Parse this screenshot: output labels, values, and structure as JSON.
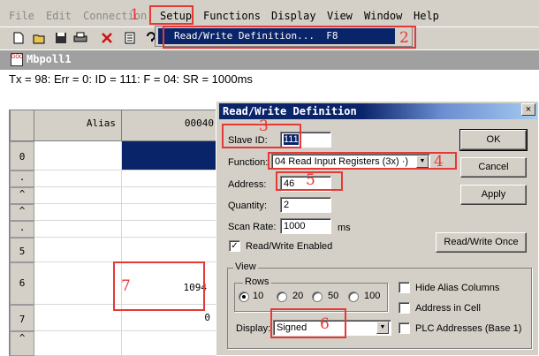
{
  "menu": [
    "File",
    "Edit",
    "Connection",
    "Setup",
    "Functions",
    "Display",
    "View",
    "Window",
    "Help"
  ],
  "setup_menu": {
    "item_label": "Read/Write Definition...",
    "item_shortcut": "F8"
  },
  "child_window": {
    "title": "Mbpoll1"
  },
  "status": "Tx = 98: Err = 0: ID = 111: F = 04: SR = 1000ms",
  "grid": {
    "alias_header": "Alias",
    "address_header": "00040",
    "rows": [
      {
        "row": "0",
        "value": ""
      },
      {
        "row": ".",
        "value": ""
      },
      {
        "row": "^",
        "value": ""
      },
      {
        "row": "^",
        "value": ""
      },
      {
        "row": ".",
        "value": ""
      },
      {
        "row": "5",
        "value": ""
      },
      {
        "row": "6",
        "value": "1094"
      },
      {
        "row": "7",
        "value": "0"
      },
      {
        "row": "^",
        "value": ""
      }
    ]
  },
  "dialog": {
    "title": "Read/Write Definition",
    "close_glyph": "×",
    "slave_id_label": "Slave ID:",
    "slave_id": "111",
    "function_label": "Function:",
    "function_value": "04 Read Input Registers (3x)",
    "function_trunc": " ·)",
    "address_label": "Address:",
    "address": "46",
    "quantity_label": "Quantity:",
    "quantity": "2",
    "scan_rate_label": "Scan Rate:",
    "scan_rate": "1000",
    "scan_rate_unit": "ms",
    "rw_enabled_label": "Read/Write Enabled",
    "rw_enabled": true,
    "ok": "OK",
    "cancel": "Cancel",
    "apply": "Apply",
    "rw_once": "Read/Write Once",
    "view_group": "View",
    "rows_group": "Rows",
    "rows_options": [
      "10",
      "20",
      "50",
      "100"
    ],
    "rows_selected": "10",
    "hide_alias": "Hide Alias Columns",
    "address_in_cell": "Address in Cell",
    "plc_addresses": "PLC Addresses (Base 1)",
    "display_label": "Display:",
    "display_value": "Signed",
    "check_mark": "✓",
    "dropdown_glyph": "▼"
  },
  "annotations": [
    "1",
    "2",
    "3",
    "4",
    "5",
    "6",
    "7"
  ],
  "colors": {
    "annotation": "#e53935",
    "selection": "#0a246a",
    "face": "#d4d0c8"
  },
  "icons": [
    "new-file-icon",
    "open-folder-icon",
    "save-icon",
    "print-icon",
    "delete-icon",
    "document-icon",
    "help-icon"
  ]
}
